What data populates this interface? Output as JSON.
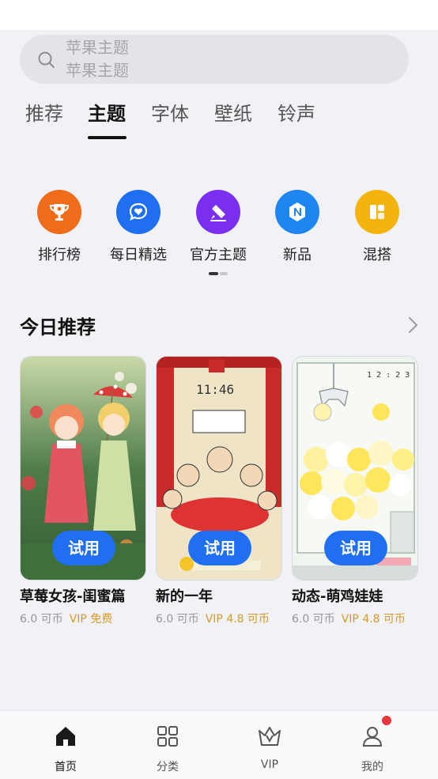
{
  "search": {
    "icon": "search-icon",
    "placeholder_lines": [
      "苹果主题",
      "苹果主题"
    ]
  },
  "tabs": [
    {
      "label": "推荐"
    },
    {
      "label": "主题",
      "active": true
    },
    {
      "label": "字体"
    },
    {
      "label": "壁纸"
    },
    {
      "label": "铃声"
    }
  ],
  "categories": [
    {
      "label": "排行榜",
      "icon": "trophy-icon",
      "color": "#ef6c1a"
    },
    {
      "label": "每日精选",
      "icon": "heart-chat-icon",
      "color": "#1f6ff0"
    },
    {
      "label": "官方主题",
      "icon": "brush-icon",
      "color": "#7a2ef0"
    },
    {
      "label": "新品",
      "icon": "new-badge-icon",
      "color": "#1f86f0"
    },
    {
      "label": "混搭",
      "icon": "mix-layout-icon",
      "color": "#f5b30e"
    }
  ],
  "section": {
    "title": "今日推荐",
    "arrow_icon": "chevron-right-icon"
  },
  "cards": [
    {
      "name": "草莓女孩-闺蜜篇",
      "coin": "6.0 可币",
      "vip": "VIP 免费",
      "try": "试用"
    },
    {
      "name": "新的一年",
      "coin": "6.0 可币",
      "vip": "VIP 4.8 可币",
      "try": "试用",
      "clock": "11:46"
    },
    {
      "name": "动态-萌鸡娃娃",
      "coin": "6.0 可币",
      "vip": "VIP 4.8 可币",
      "try": "试用",
      "clock": "1 2 : 2 3"
    }
  ],
  "nav": [
    {
      "label": "首页",
      "icon": "home-icon",
      "active": true
    },
    {
      "label": "分类",
      "icon": "grid-icon"
    },
    {
      "label": "VIP",
      "icon": "crown-icon"
    },
    {
      "label": "我的",
      "icon": "user-icon"
    }
  ],
  "colors": {
    "accent": "#1f6ff0",
    "vip": "#d89a2a",
    "badge": "#e8363d"
  }
}
